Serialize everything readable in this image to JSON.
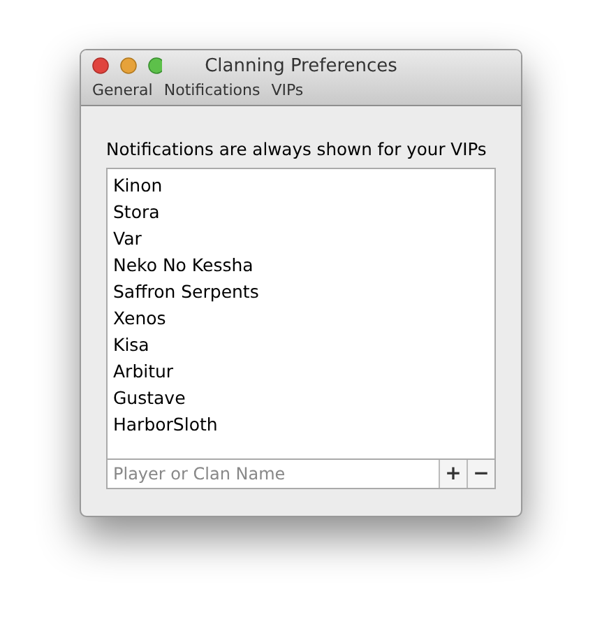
{
  "window": {
    "title": "Clanning Preferences"
  },
  "toolbar": [
    {
      "label": "General"
    },
    {
      "label": "Notifications"
    },
    {
      "label": "VIPs"
    }
  ],
  "heading": "Notifications are always shown for your VIPs",
  "vips": [
    "Kinon",
    "Stora",
    "Var",
    "Neko No Kessha",
    "Saffron Serpents",
    "Xenos",
    "Kisa",
    "Arbitur",
    "Gustave",
    "HarborSloth"
  ],
  "name_field": {
    "placeholder": "Player or Clan Name"
  },
  "add_button": "+",
  "remove_button": "−"
}
